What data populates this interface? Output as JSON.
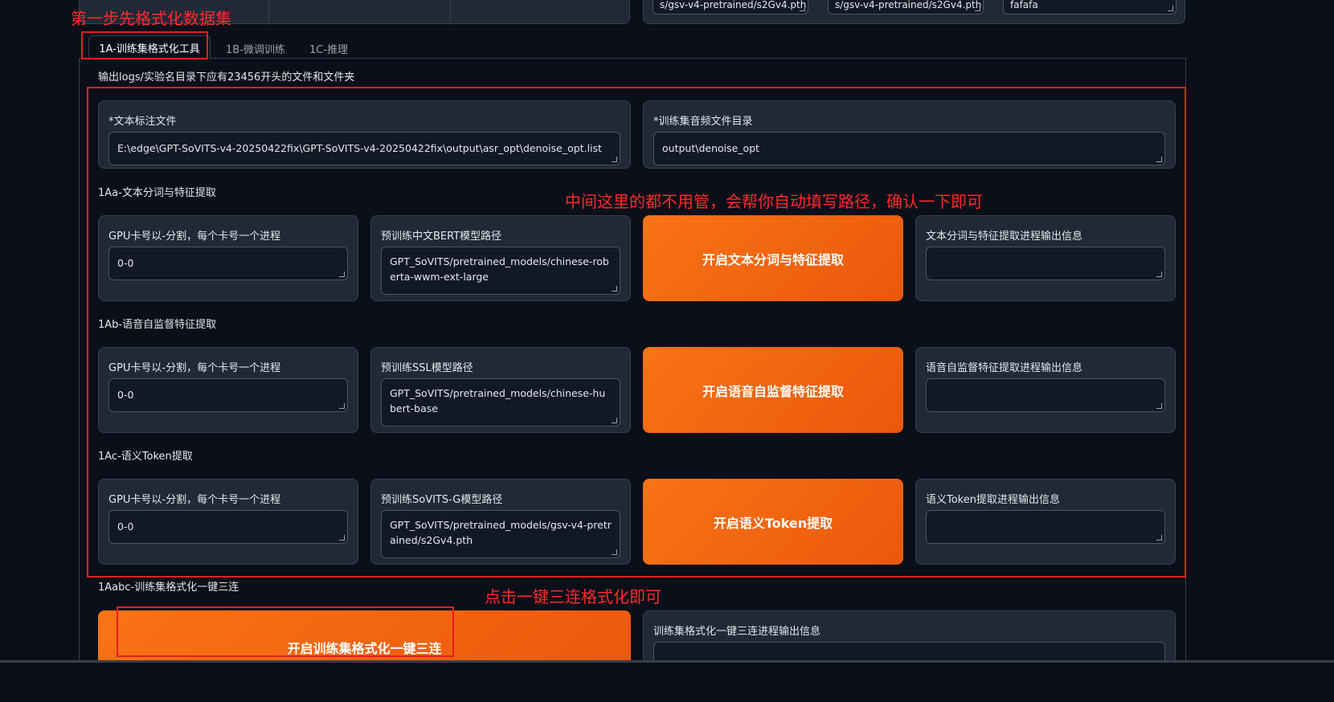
{
  "annotations": {
    "step1": "第一步先格式化数据集",
    "middle": "中间这里的都不用管，会帮你自动填写路径，确认一下即可",
    "oneclick": "点击一键三连格式化即可"
  },
  "top_fields": {
    "f1": "s/gsv-v4-pretrained/s2Gv4.pth",
    "f2": "s/gsv-v4-pretrained/s2Gv4.pth",
    "f3": "fafafa"
  },
  "tabs": [
    {
      "label": "1A-训练集格式化工具"
    },
    {
      "label": "1B-微调训练"
    },
    {
      "label": "1C-推理"
    }
  ],
  "output_hint": "输出logs/实验名目录下应有23456开头的文件和文件夹",
  "text_label_file": {
    "label": "*文本标注文件",
    "value": "E:\\edge\\GPT-SoVITS-v4-20250422fix\\GPT-SoVITS-v4-20250422fix\\output\\asr_opt\\denoise_opt.list"
  },
  "audio_dir": {
    "label": "*训练集音频文件目录",
    "value": "output\\denoise_opt"
  },
  "sections": [
    {
      "title": "1Aa-文本分词与特征提取",
      "gpu_label": "GPU卡号以-分割，每个卡号一个进程",
      "gpu_value": "0-0",
      "model_label": "预训练中文BERT模型路径",
      "model_value": "GPT_SoVITS/pretrained_models/chinese-roberta-wwm-ext-large",
      "button": "开启文本分词与特征提取",
      "output_label": "文本分词与特征提取进程输出信息",
      "output_value": ""
    },
    {
      "title": "1Ab-语音自监督特征提取",
      "gpu_label": "GPU卡号以-分割，每个卡号一个进程",
      "gpu_value": "0-0",
      "model_label": "预训练SSL模型路径",
      "model_value": "GPT_SoVITS/pretrained_models/chinese-hubert-base",
      "button": "开启语音自监督特征提取",
      "output_label": "语音自监督特征提取进程输出信息",
      "output_value": ""
    },
    {
      "title": "1Ac-语义Token提取",
      "gpu_label": "GPU卡号以-分割，每个卡号一个进程",
      "gpu_value": "0-0",
      "model_label": "预训练SoVITS-G模型路径",
      "model_value": "GPT_SoVITS/pretrained_models/gsv-v4-pretrained/s2Gv4.pth",
      "button": "开启语义Token提取",
      "output_label": "语义Token提取进程输出信息",
      "output_value": ""
    }
  ],
  "oneclick": {
    "title": "1Aabc-训练集格式化一键三连",
    "button": "开启训练集格式化一键三连",
    "output_label": "训练集格式化一键三连进程输出信息",
    "output_value": ""
  },
  "colors": {
    "accent": "#f97316",
    "annotation_red": "#e02020",
    "background": "#0b0f19",
    "panel": "#1f2937"
  }
}
